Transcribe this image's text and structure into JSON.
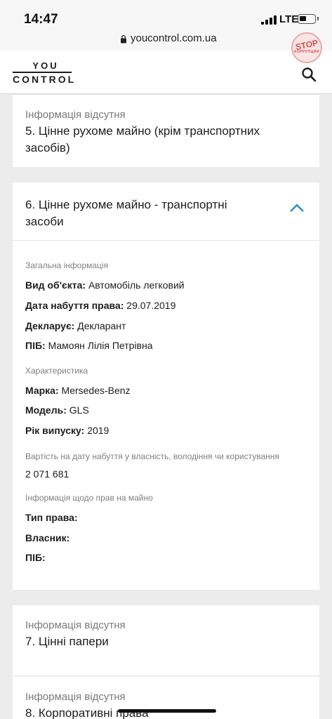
{
  "status_bar": {
    "time": "14:47",
    "network": "LTE"
  },
  "browser": {
    "url": "youcontrol.com.ua"
  },
  "stamp": {
    "line1": "STOP",
    "line2": "КОРРУПЦИИ",
    "color": "#d23c3c"
  },
  "header": {
    "logo_top": "YOU",
    "logo_bottom": "CONTROL",
    "search_icon": "search-icon"
  },
  "sections": {
    "s5": {
      "status": "Інформація відсутня",
      "title": "5. Цінне рухоме майно (крім транспортних засобів)"
    },
    "s6": {
      "title": "6. Цінне рухоме майно - транспортні засоби",
      "chevron_color": "#2a8dd1",
      "general": {
        "label": "Загальна інформація",
        "rows": [
          {
            "key": "Вид об'єкта:",
            "value": "Автомобіль легковий"
          },
          {
            "key": "Дата набуття права:",
            "value": "29.07.2019"
          },
          {
            "key": "Декларує:",
            "value": "Декларант"
          },
          {
            "key": "ПІБ:",
            "value": "Мамоян Лілія Петрівна"
          }
        ]
      },
      "specs": {
        "label": "Характеристика",
        "rows": [
          {
            "key": "Марка:",
            "value": "Mersedes-Benz"
          },
          {
            "key": "Модель:",
            "value": "GLS"
          },
          {
            "key": "Рік випуску:",
            "value": "2019"
          }
        ]
      },
      "cost": {
        "label": "Вартість на дату набуття у власність, володіння чи користування",
        "value": "2 071 681"
      },
      "rights": {
        "label": "Інформація щодо прав на майно",
        "rows": [
          {
            "key": "Тип права:",
            "value": ""
          },
          {
            "key": "Власник:",
            "value": ""
          },
          {
            "key": "ПІБ:",
            "value": ""
          }
        ]
      }
    },
    "s7": {
      "status": "Інформація відсутня",
      "title": "7. Цінні папери"
    },
    "s8": {
      "status": "Інформація відсутня",
      "title": "8. Корпоративні права"
    }
  }
}
